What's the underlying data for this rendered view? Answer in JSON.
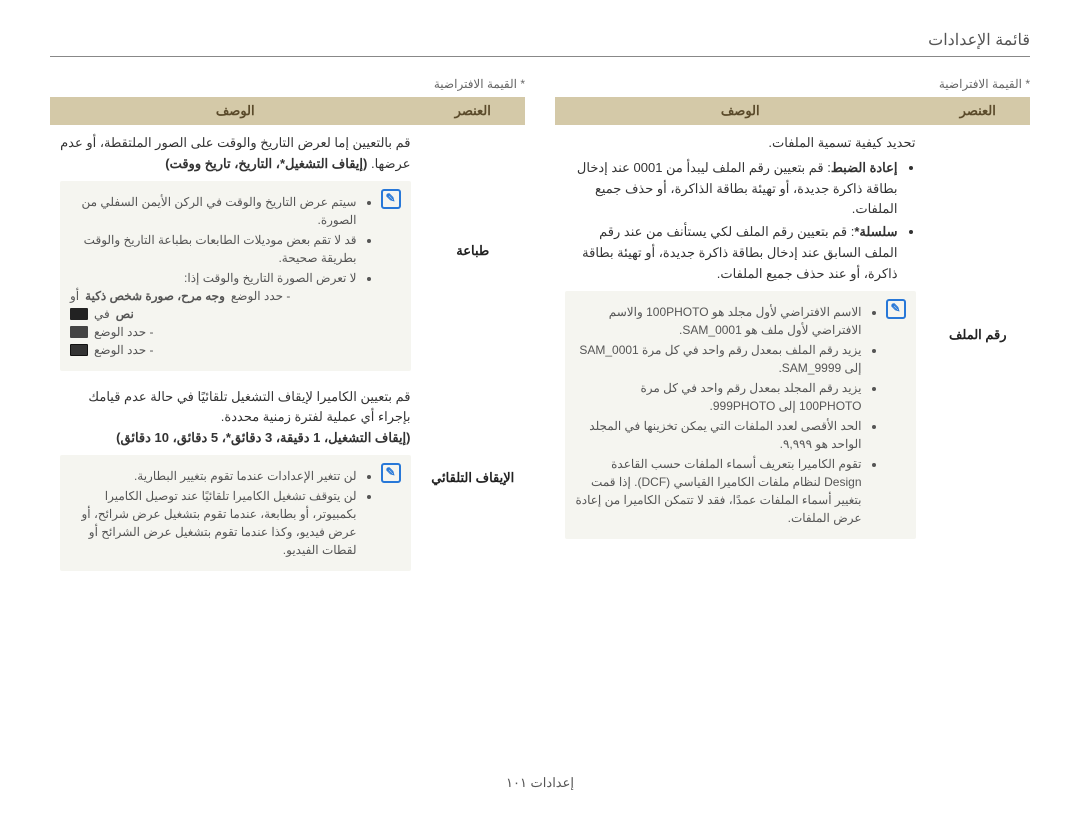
{
  "header": {
    "title": "قائمة الإعدادات"
  },
  "footer": {
    "text": "إعدادات ١٠١"
  },
  "labels": {
    "default": "* القيمة الافتراضية",
    "item_header": "العنصر",
    "desc_header": "الوصف"
  },
  "right_col": {
    "row1": {
      "item": "رقم الملف",
      "intro": "تحديد كيفية تسمية الملفات.",
      "reset_bold": "إعادة الضبط",
      "reset_rest": ": قم بتعيين رقم الملف ليبدأ من 0001 عند إدخال بطاقة ذاكرة جديدة، أو تهيئة بطاقة الذاكرة، أو حذف جميع الملفات.",
      "series_bold": "سلسلة*",
      "series_rest": ": قم بتعيين رقم الملف لكي يستأنف من عند رقم الملف السابق عند إدخال بطاقة ذاكرة جديدة، أو تهيئة بطاقة ذاكرة، أو عند حذف جميع الملفات.",
      "note1": "الاسم الافتراضي لأول مجلد هو 100PHOTO والاسم الافتراضي لأول ملف هو SAM_0001.",
      "note2": "يزيد رقم الملف بمعدل رقم واحد في كل مرة SAM_0001 إلى SAM_9999.",
      "note3": "يزيد رقم المجلد بمعدل رقم واحد في كل مرة 100PHOTO إلى 999PHOTO.",
      "note4": "الحد الأقصى لعدد الملفات التي يمكن تخزينها في المجلد الواحد هو ٩,٩٩٩.",
      "note5": "تقوم الكاميرا بتعريف أسماء الملفات حسب القاعدة Design لنظام ملفات الكاميرا القياسي (DCF). إذا قمت بتغيير أسماء الملفات عمدًا، فقد لا تتمكن الكاميرا من إعادة عرض الملفات."
    }
  },
  "left_col": {
    "row1": {
      "item": "طباعة",
      "intro": "قم بالتعيين إما لعرض التاريخ والوقت على الصور الملتقطة، أو عدم عرضها.",
      "options": "(إيقاف التشغيل*، التاريخ، تاريخ ووقت)",
      "note1": "سيتم عرض التاريخ والوقت في الركن الأيمن السفلي من الصورة.",
      "note2": "قد لا تقم بعض موديلات الطابعات بطباعة التاريخ والوقت بطريقة صحيحة.",
      "note3_intro": "لا تعرض الصورة التاريخ والوقت إذا:",
      "note3_sub1_prefix": "- حدد الوضع",
      "note3_sub1_bold": "وجه مرح، صورة شخص ذكية",
      "note3_sub1_suffix": "أو",
      "note3_sub2_prefix": "نص",
      "note3_sub2_suffix": "في",
      "note3_sub3": "- حدد الوضع",
      "note3_sub4": "- حدد الوضع"
    },
    "row2": {
      "item": "الإيقاف التلقائي",
      "intro": "قم بتعيين الكاميرا لإيقاف التشغيل تلقائيًا في حالة عدم قيامك بإجراء أي عملية لفترة زمنية محددة.",
      "options": "(إيقاف التشغيل، 1 دقيقة، 3 دقائق*، 5 دقائق، 10 دقائق)",
      "note1": "لن تتغير الإعدادات عندما تقوم بتغيير البطارية.",
      "note2": "لن يتوقف تشغيل الكاميرا تلقائيًا عند توصيل الكاميرا بكمبيوتر، أو بطابعة، عندما تقوم بتشغيل عرض شرائح، أو عرض فيديو، وكذا عندما تقوم بتشغيل عرض الشرائح أو لقطات الفيديو."
    }
  }
}
